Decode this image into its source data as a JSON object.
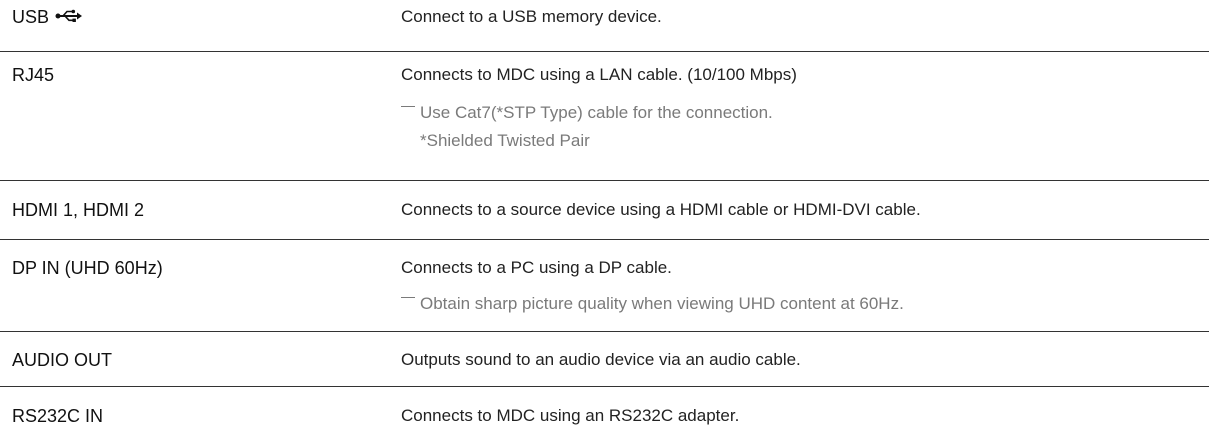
{
  "rows": [
    {
      "port": "USB",
      "icon": "usb-icon",
      "description": "Connect to a USB memory device."
    },
    {
      "port": "RJ45",
      "description": "Connects to MDC using a LAN cable. (10/100 Mbps)",
      "note": "Use Cat7(*STP Type) cable for the connection.",
      "subnote": "*Shielded Twisted Pair"
    },
    {
      "port": "HDMI 1, HDMI 2",
      "description": "Connects to a source device using a HDMI cable or HDMI-DVI cable."
    },
    {
      "port": "DP IN (UHD 60Hz)",
      "description": "Connects to a PC using a DP cable.",
      "note": "Obtain sharp picture quality when viewing UHD content at 60Hz."
    },
    {
      "port": "AUDIO OUT",
      "description": "Outputs sound to an audio device via an audio cable."
    },
    {
      "port": "RS232C IN",
      "description": "Connects to MDC using an RS232C adapter."
    }
  ]
}
